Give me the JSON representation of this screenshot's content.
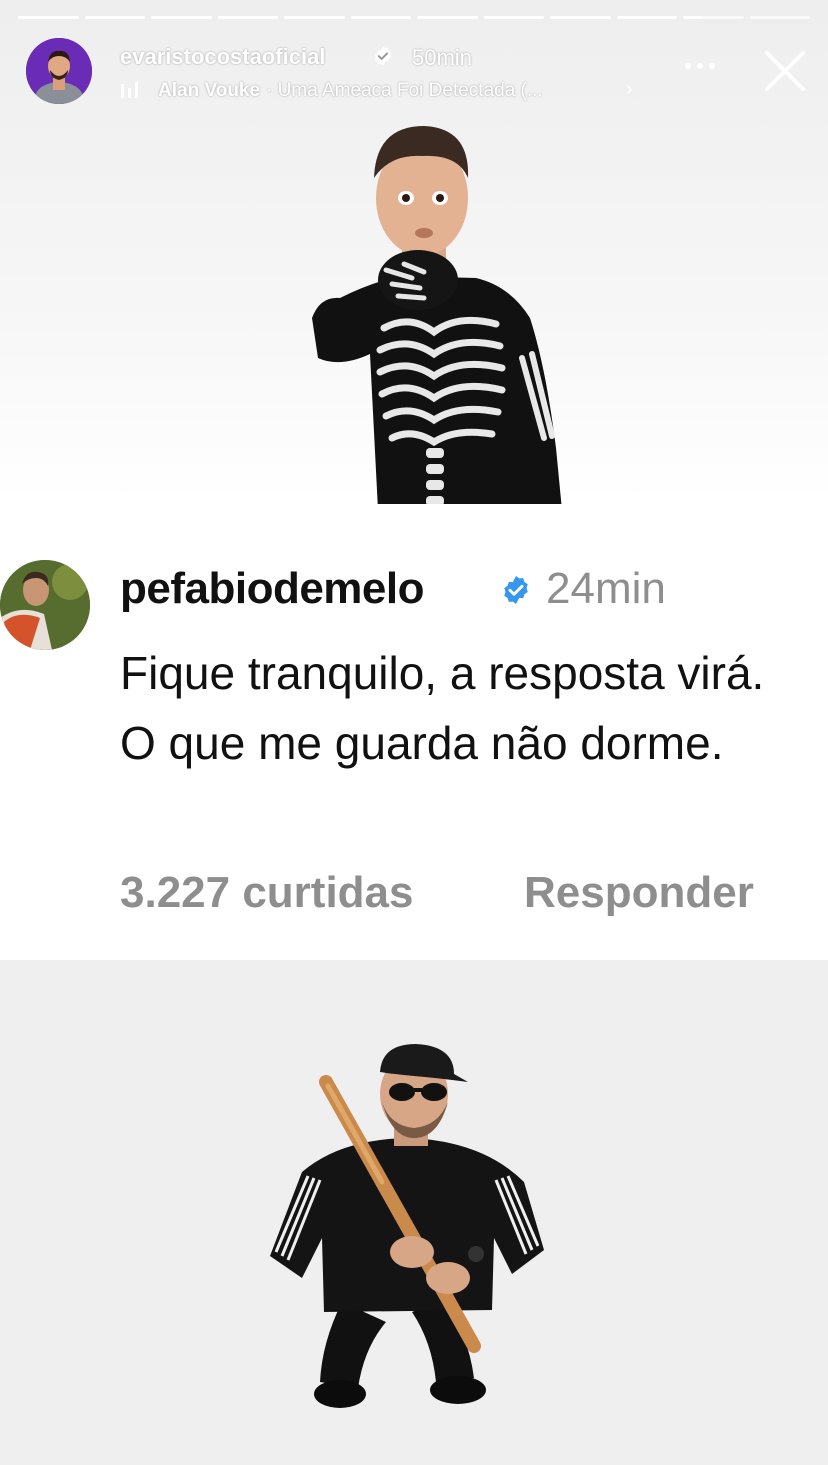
{
  "progress": {
    "segments": 12,
    "completed": 10,
    "current_fraction": 0.3
  },
  "header": {
    "username": "evaristocostaoficial",
    "time": "50min",
    "music": {
      "artist": "Alan Vouke",
      "track": "· Uma Ameaca Foi Detectada (..."
    }
  },
  "comment": {
    "username": "pefabiodemelo",
    "time": "24min",
    "text": "Fique tranquilo, a resposta virá. O que me guarda não dorme.",
    "likes": "3.227 curtidas",
    "reply_label": "Responder"
  },
  "colors": {
    "verified": "#3797f0",
    "secondary_text": "#8e8e8e",
    "avatar_bg": "#6a2bb7"
  },
  "icons": {
    "music": "music-bars-icon",
    "more": "more-dots-icon",
    "close": "close-icon",
    "verified": "verified-badge-icon"
  }
}
